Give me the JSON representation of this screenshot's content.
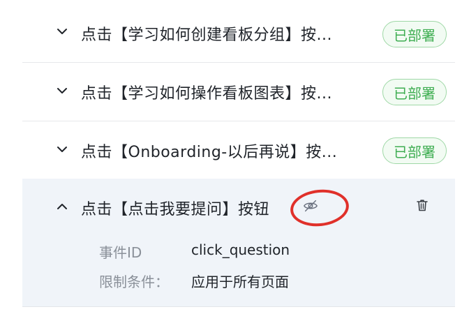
{
  "events": [
    {
      "title": "点击【学习如何创建看板分组】按...",
      "status": "已部署",
      "expanded": false
    },
    {
      "title": "点击【学习如何操作看板图表】按...",
      "status": "已部署",
      "expanded": false
    },
    {
      "title": "点击【Onboarding-以后再说】按...",
      "status": "已部署",
      "expanded": false
    }
  ],
  "active_event": {
    "title": "点击【点击我要提问】按钮",
    "fields": [
      {
        "label": "事件ID",
        "value": "click_question"
      },
      {
        "label": "限制条件：",
        "value": "应用于所有页面"
      }
    ]
  },
  "icons": {
    "collapsed": "chevron-down-icon",
    "expanded": "chevron-up-icon",
    "visibility": "eye-off-icon",
    "delete": "trash-icon"
  },
  "colors": {
    "badge_green": "#3fae52",
    "badge_border": "#9fd8a6",
    "highlight_bg": "#f0f4f9",
    "annotation_red": "#e0302a"
  }
}
